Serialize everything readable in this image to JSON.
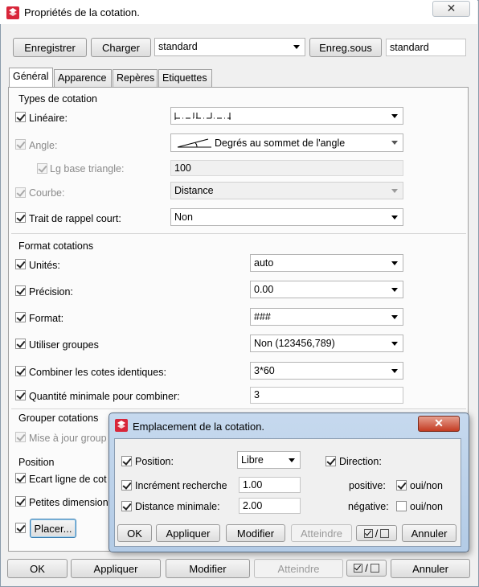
{
  "window": {
    "title": "Propriétés de la cotation.",
    "close": "✕"
  },
  "toolbar": {
    "save": "Enregistrer",
    "load": "Charger",
    "preset": "standard",
    "save_as": "Enreg.sous",
    "save_as_name": "standard"
  },
  "tabs": [
    "Général",
    "Apparence",
    "Repères",
    "Etiquettes"
  ],
  "types": {
    "title": "Types de cotation",
    "lineaire": "Linéaire:",
    "angle": "Angle:",
    "angle_value": "Degrés au sommet de l'angle",
    "lg_base": "Lg base triangle:",
    "lg_base_value": "100",
    "courbe": "Courbe:",
    "courbe_value": "Distance",
    "trait": "Trait de rappel court:",
    "trait_value": "Non"
  },
  "format": {
    "title": "Format cotations",
    "unites": "Unités:",
    "unites_value": "auto",
    "precision": "Précision:",
    "precision_value": "0.00",
    "format": "Format:",
    "format_value": "###",
    "groupes": "Utiliser groupes",
    "groupes_value": "Non (123456,789)",
    "combiner": "Combiner les cotes identiques:",
    "combiner_value": "3*60",
    "quantite": "Quantité minimale pour combiner:",
    "quantite_value": "3"
  },
  "grouper": {
    "title": "Grouper cotations",
    "maj": "Mise à jour group"
  },
  "position": {
    "title": "Position",
    "ecart": "Ecart ligne de cot",
    "petites": "Petites dimension",
    "placer": "Placer..."
  },
  "bottom": {
    "ok": "OK",
    "appliquer": "Appliquer",
    "modifier": "Modifier",
    "atteindre": "Atteindre",
    "toggle": "/",
    "annuler": "Annuler"
  },
  "subdialog": {
    "title": "Emplacement de la cotation.",
    "close": "✕",
    "position": "Position:",
    "position_value": "Libre",
    "direction": "Direction:",
    "increment": "Incrément recherche",
    "increment_value": "1.00",
    "positive": "positive:",
    "ouinon": "oui/non",
    "distance": "Distance minimale:",
    "distance_value": "2.00",
    "negative": "négative:",
    "ok": "OK",
    "appliquer": "Appliquer",
    "modifier": "Modifier",
    "atteindre": "Atteindre",
    "toggle": "/",
    "annuler": "Annuler"
  }
}
